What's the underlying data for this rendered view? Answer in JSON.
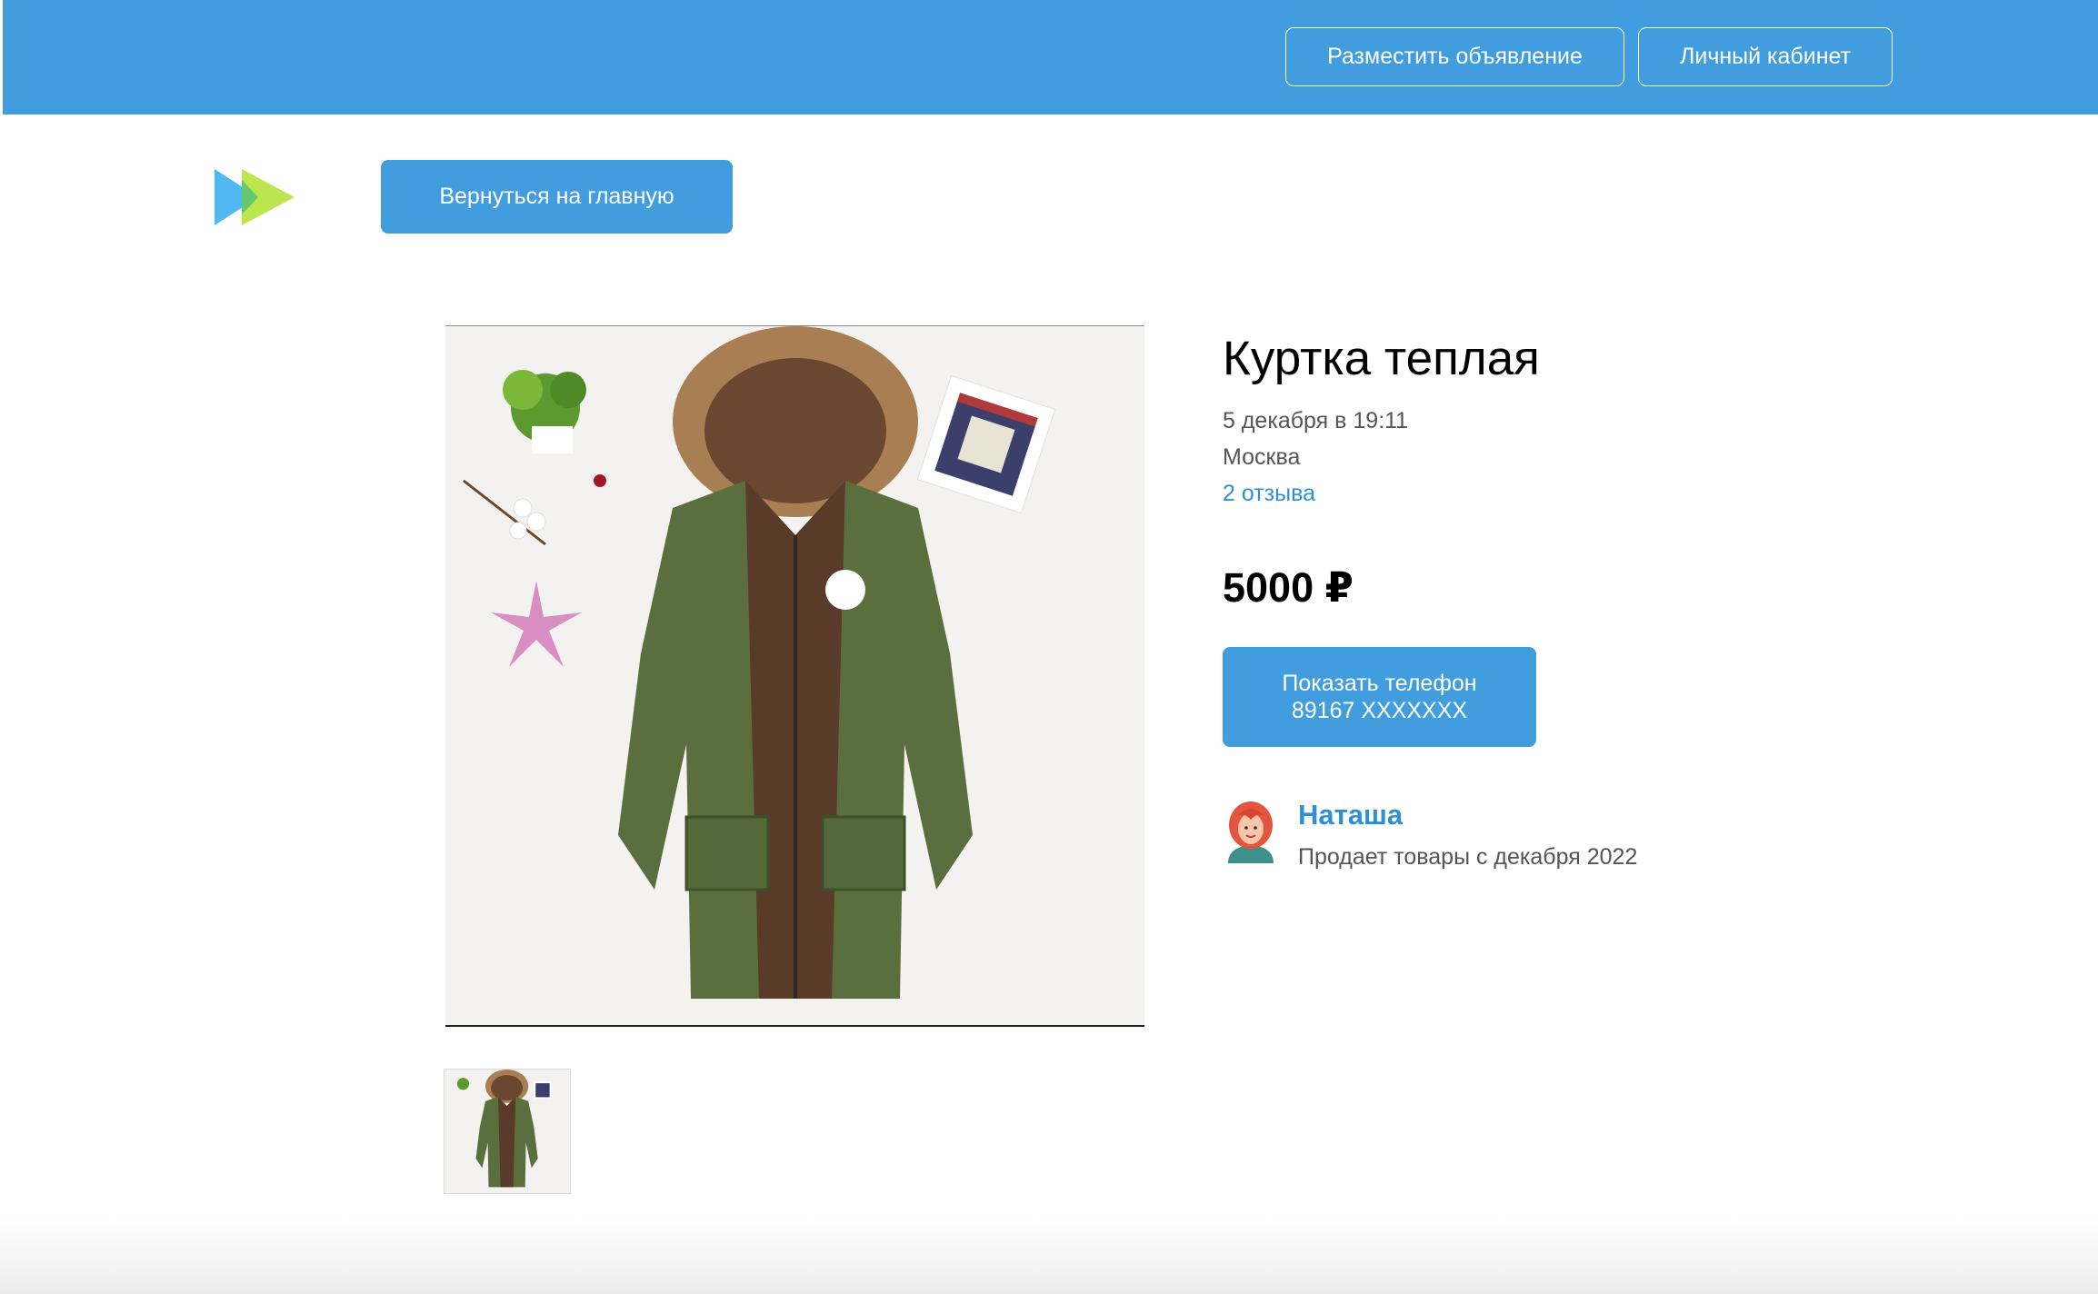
{
  "header": {
    "post_ad_label": "Разместить объявление",
    "account_label": "Личный кабинет"
  },
  "nav": {
    "back_label": "Вернуться на главную",
    "logo_icon": "play-forward-logo-icon"
  },
  "colors": {
    "brand": "#429ddf",
    "link": "#2f8fd6",
    "logo_blue": "#51b8f2",
    "logo_green": "#b6e23a"
  },
  "product": {
    "title": "Куртка теплая",
    "date": "5 декабря в 19:11",
    "city": "Москва",
    "reviews": "2 отзыва",
    "price": "5000 ₽",
    "phone_button_line1": "Показать телефон",
    "phone_button_line2": "89167 XXXXXXX",
    "photo_icon": "green-parka-photo",
    "thumbnails": [
      "green-parka-thumbnail"
    ]
  },
  "seller": {
    "name": "Наташа",
    "since": "Продает товары с декабря 2022",
    "avatar_icon": "red-haired-woman-avatar"
  }
}
